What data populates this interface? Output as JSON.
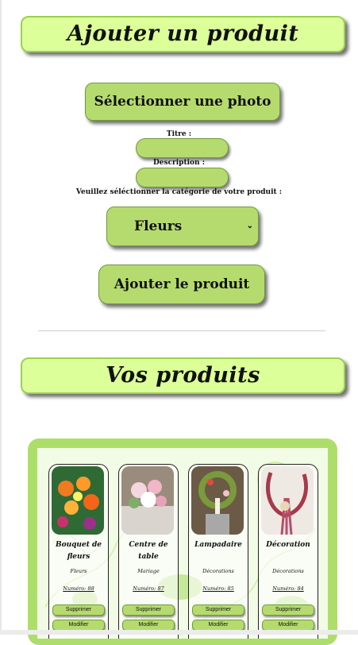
{
  "add_section": {
    "title": "Ajouter un produit",
    "photo_button": "Sélectionner une photo",
    "title_label": "Titre :",
    "description_label": "Description :",
    "category_label": "Veuillez séléctionner la catégorie de votre produit :",
    "category_selected": "Fleurs",
    "chevron": "⌄",
    "submit_button": "Ajouter le produit"
  },
  "products_section": {
    "title": "Vos produits",
    "delete_label": "Supprimer",
    "edit_label": "Modifier",
    "products": [
      {
        "title": "Bouquet de fleurs",
        "category": "Fleurs",
        "number": "Numéro: 88"
      },
      {
        "title": "Centre de table",
        "category": "Mariage",
        "number": "Numéro: 87"
      },
      {
        "title": "Lampadaire",
        "category": "Décorations",
        "number": "Numéro: 85"
      },
      {
        "title": "Décoration",
        "category": "Décorations",
        "number": "Numéro: 84"
      }
    ]
  },
  "colors": {
    "banner_bg": "#dcff99",
    "button_bg": "#b5db6e",
    "panel_bg": "#aede6a"
  }
}
